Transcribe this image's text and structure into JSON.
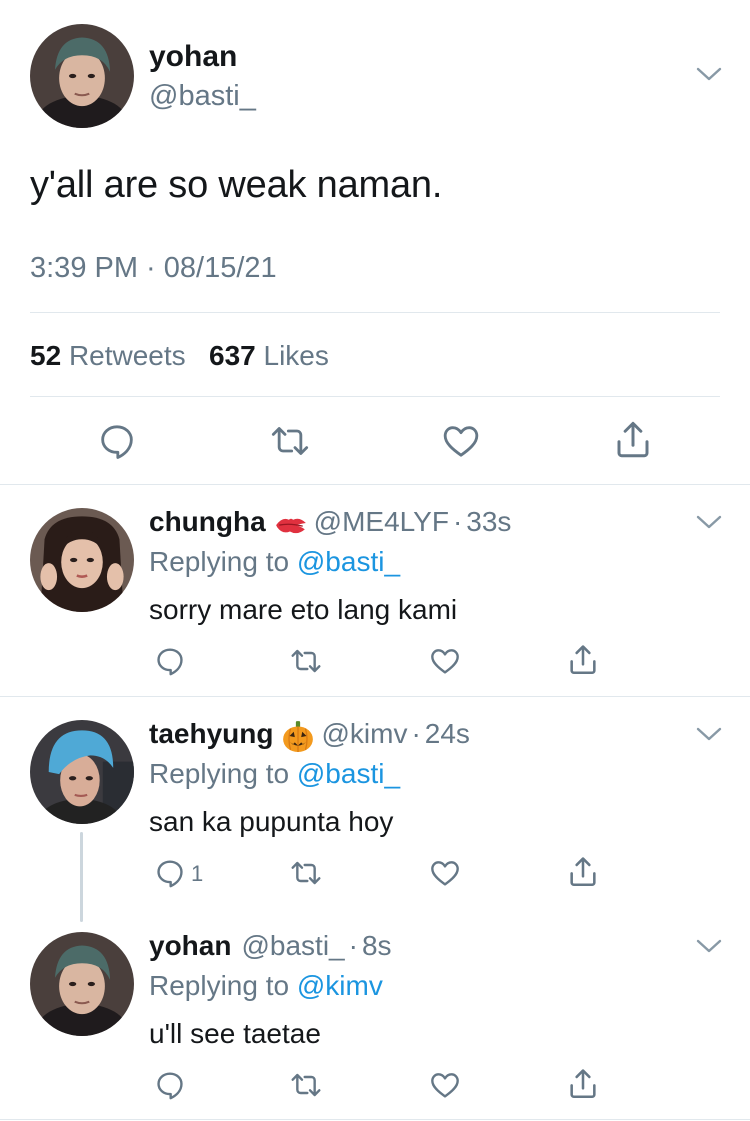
{
  "main_tweet": {
    "display_name": "yohan",
    "handle": "@basti_",
    "text": "y'all are so weak naman.",
    "timestamp": "3:39 PM · 08/15/21",
    "retweets_count": "52",
    "retweets_label": "Retweets",
    "likes_count": "637",
    "likes_label": "Likes"
  },
  "replies": [
    {
      "display_name": "chungha",
      "name_emoji": "kiss-mark-icon",
      "handle": "@ME4LYF",
      "time": "33s",
      "replying_prefix": "Replying to",
      "replying_to": "@basti_",
      "text": "sorry mare eto lang kami",
      "reply_count": ""
    },
    {
      "display_name": "taehyung",
      "name_emoji": "jack-o-lantern-icon",
      "handle": "@kimv",
      "time": "24s",
      "replying_prefix": "Replying to",
      "replying_to": "@basti_",
      "text": "san ka pupunta hoy",
      "reply_count": "1"
    },
    {
      "display_name": "yohan",
      "name_emoji": "",
      "handle": "@basti_",
      "time": "8s",
      "replying_prefix": "Replying to",
      "replying_to": "@kimv",
      "text": "u'll see taetae",
      "reply_count": ""
    }
  ],
  "meta_separator": "·",
  "colors": {
    "text": "#14171a",
    "secondary": "#657786",
    "link": "#1b95e0",
    "divider": "#e1e8ed",
    "icon": "#657786"
  }
}
